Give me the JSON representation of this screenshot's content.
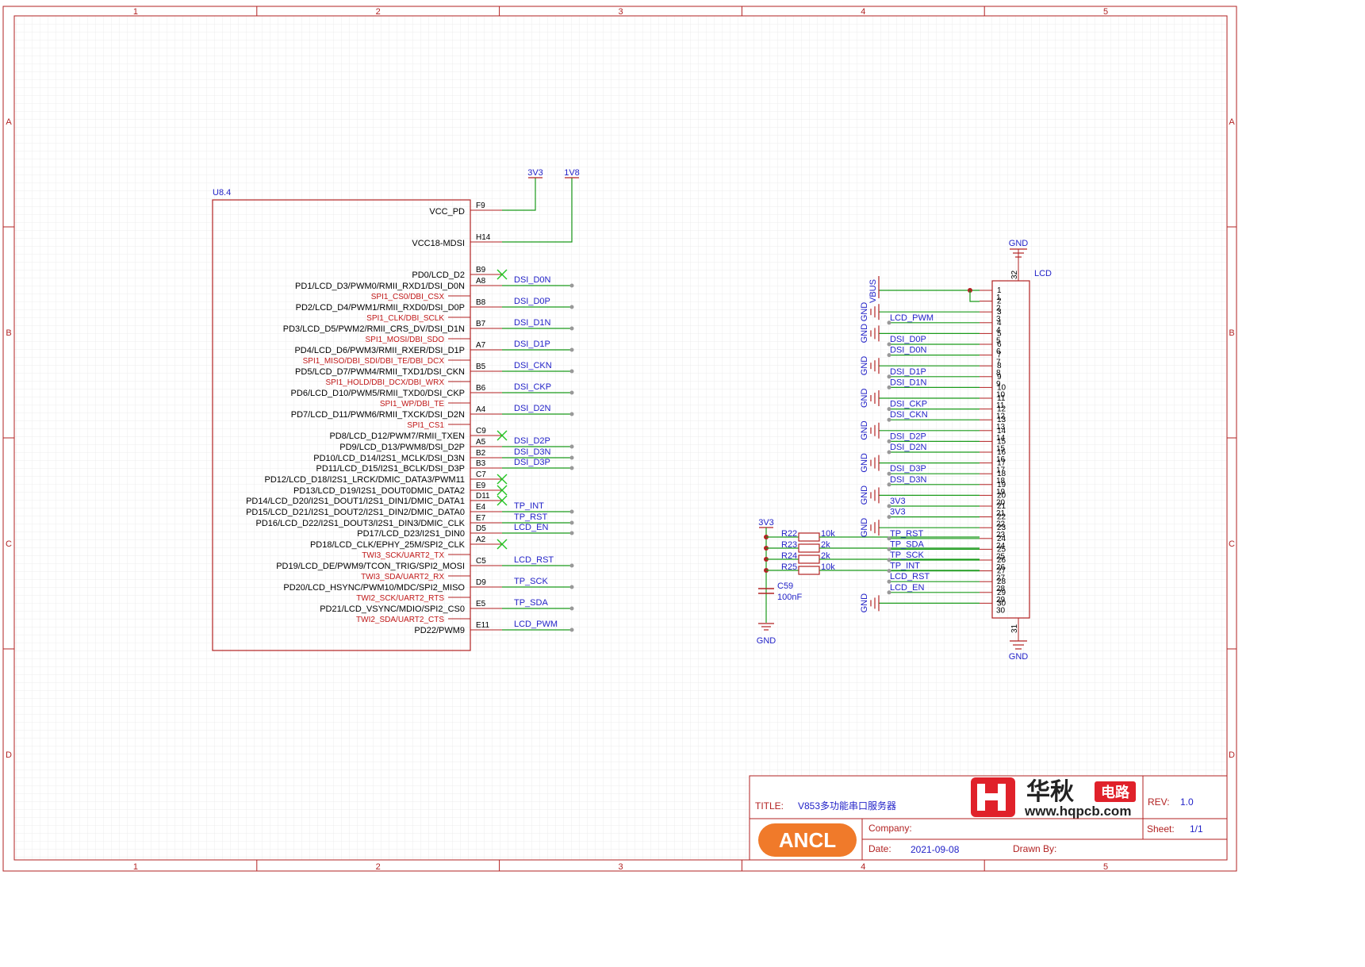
{
  "border": {
    "columns": [
      "1",
      "2",
      "3",
      "4",
      "5"
    ],
    "rows": [
      "A",
      "B",
      "C",
      "D"
    ]
  },
  "supply": {
    "rail_3v3": "3V3",
    "rail_1v8": "1V8"
  },
  "u84": {
    "ref": "U8.4",
    "power_pins": [
      {
        "name": "VCC_PD",
        "pin": "F9"
      },
      {
        "name": "VCC18-MDSI",
        "pin": "H14"
      }
    ],
    "pins": [
      {
        "name": "PD0/LCD_D2",
        "pin": "B9",
        "net": "",
        "nc": true,
        "alt": "",
        "type": "pd"
      },
      {
        "name": "PD1/LCD_D3/PWM0/RMII_RXD1/DSI_D0N",
        "pin": "A8",
        "net": "DSI_D0N",
        "nc": false,
        "alt": "SPI1_CS0/DBI_CSX",
        "type": "pd"
      },
      {
        "name": "PD2/LCD_D4/PWM1/RMII_RXD0/DSI_D0P",
        "pin": "B8",
        "net": "DSI_D0P",
        "nc": false,
        "alt": "SPI1_CLK/DBI_SCLK",
        "type": "pd"
      },
      {
        "name": "PD3/LCD_D5/PWM2/RMII_CRS_DV/DSI_D1N",
        "pin": "B7",
        "net": "DSI_D1N",
        "nc": false,
        "alt": "SPI1_MOSI/DBI_SDO",
        "type": "pd"
      },
      {
        "name": "PD4/LCD_D6/PWM3/RMII_RXER/DSI_D1P",
        "pin": "A7",
        "net": "DSI_D1P",
        "nc": false,
        "alt": "SPI1_MISO/DBI_SDI/DBI_TE/DBI_DCX",
        "type": "pd"
      },
      {
        "name": "PD5/LCD_D7/PWM4/RMII_TXD1/DSI_CKN",
        "pin": "B5",
        "net": "DSI_CKN",
        "nc": false,
        "alt": "SPI1_HOLD/DBI_DCX/DBI_WRX",
        "type": "pd"
      },
      {
        "name": "PD6/LCD_D10/PWM5/RMII_TXD0/DSI_CKP",
        "pin": "B6",
        "net": "DSI_CKP",
        "nc": false,
        "alt": "SPI1_WP/DBI_TE",
        "type": "pd"
      },
      {
        "name": "PD7/LCD_D11/PWM6/RMII_TXCK/DSI_D2N",
        "pin": "A4",
        "net": "DSI_D2N",
        "nc": false,
        "alt": "SPI1_CS1",
        "type": "pd"
      },
      {
        "name": "PD8/LCD_D12/PWM7/RMII_TXEN",
        "pin": "C9",
        "net": "",
        "nc": true,
        "alt": "",
        "type": "pd"
      },
      {
        "name": "PD9/LCD_D13/PWM8/DSI_D2P",
        "pin": "A5",
        "net": "DSI_D2P",
        "nc": false,
        "alt": "",
        "type": "pd"
      },
      {
        "name": "PD10/LCD_D14/I2S1_MCLK/DSI_D3N",
        "pin": "B2",
        "net": "DSI_D3N",
        "nc": false,
        "alt": "",
        "type": "pd"
      },
      {
        "name": "PD11/LCD_D15/I2S1_BCLK/DSI_D3P",
        "pin": "B3",
        "net": "DSI_D3P",
        "nc": false,
        "alt": "",
        "type": "pd"
      },
      {
        "name": "PD12/LCD_D18/I2S1_LRCK/DMIC_DATA3/PWM11",
        "pin": "C7",
        "net": "",
        "nc": true,
        "alt": "",
        "type": "pd"
      },
      {
        "name": "PD13/LCD_D19/I2S1_DOUT0DMIC_DATA2",
        "pin": "E9",
        "net": "",
        "nc": true,
        "alt": "",
        "type": "pd"
      },
      {
        "name": "PD14/LCD_D20/I2S1_DOUT1/I2S1_DIN1/DMIC_DATA1",
        "pin": "D11",
        "net": "",
        "nc": true,
        "alt": "",
        "type": "pd"
      },
      {
        "name": "PD15/LCD_D21/I2S1_DOUT2/I2S1_DIN2/DMIC_DATA0",
        "pin": "E4",
        "net": "TP_INT",
        "nc": false,
        "alt": "",
        "type": "pd"
      },
      {
        "name": "PD16/LCD_D22/I2S1_DOUT3/I2S1_DIN3/DMIC_CLK",
        "pin": "E7",
        "net": "TP_RST",
        "nc": false,
        "alt": "",
        "type": "pd"
      },
      {
        "name": "PD17/LCD_D23/I2S1_DIN0",
        "pin": "D5",
        "net": "LCD_EN",
        "nc": false,
        "alt": "",
        "type": "pd"
      },
      {
        "name": "PD18/LCD_CLK/EPHY_25M/SPI2_CLK",
        "pin": "A2",
        "net": "",
        "nc": true,
        "alt": "TWI3_SCK/UART2_TX",
        "type": "pd"
      },
      {
        "name": "PD19/LCD_DE/PWM9/TCON_TRIG/SPI2_MOSI",
        "pin": "C5",
        "net": "LCD_RST",
        "nc": false,
        "alt": "TWI3_SDA/UART2_RX",
        "type": "pd"
      },
      {
        "name": "PD20/LCD_HSYNC/PWM10/MDC/SPI2_MISO",
        "pin": "D9",
        "net": "TP_SCK",
        "nc": false,
        "alt": "TWI2_SCK/UART2_RTS",
        "type": "pd"
      },
      {
        "name": "PD21/LCD_VSYNC/MDIO/SPI2_CS0",
        "pin": "E5",
        "net": "TP_SDA",
        "nc": false,
        "alt": "TWI2_SDA/UART2_CTS",
        "type": "pd"
      },
      {
        "name": "PD22/PWM9",
        "pin": "E11",
        "net": "LCD_PWM",
        "nc": false,
        "alt": "",
        "type": "pd"
      }
    ]
  },
  "lcd": {
    "ref": "LCD",
    "gnd": "GND",
    "vbus": "VBUS",
    "top_pin": "32",
    "bottom_pin": "31",
    "left_nets": [
      "VBUS",
      "",
      "GND",
      "LCD_PWM",
      "GND",
      "DSI_D0P",
      "DSI_D0N",
      "GND",
      "DSI_D1P",
      "DSI_D1N",
      "GND",
      "DSI_CKP",
      "DSI_CKN",
      "GND",
      "DSI_D2P",
      "DSI_D2N",
      "GND",
      "DSI_D3P",
      "DSI_D3N",
      "GND",
      "3V3",
      "3V3",
      "GND",
      "TP_RST",
      "TP_SDA",
      "TP_SCK",
      "TP_INT",
      "LCD_RST",
      "LCD_EN",
      "GND"
    ],
    "pin_numbers": [
      "1",
      "2",
      "3",
      "4",
      "5",
      "6",
      "7",
      "8",
      "9",
      "10",
      "11",
      "12",
      "13",
      "14",
      "15",
      "16",
      "17",
      "18",
      "19",
      "20",
      "21",
      "22",
      "23",
      "24",
      "25",
      "26",
      "27",
      "28",
      "29",
      "30"
    ]
  },
  "pullups": {
    "rail": "3V3",
    "resistors": [
      {
        "ref": "R22",
        "value": "10k"
      },
      {
        "ref": "R23",
        "value": "2k"
      },
      {
        "ref": "R24",
        "value": "2k"
      },
      {
        "ref": "R25",
        "value": "10k"
      }
    ],
    "cap_ref": "C59",
    "cap_value": "100nF",
    "gnd": "GND"
  },
  "title_block": {
    "title_label": "TITLE:",
    "title": "V853多功能串口服务器",
    "rev_label": "REV:",
    "rev": "1.0",
    "company_label": "Company:",
    "sheet_label": "Sheet:",
    "sheet": "1/1",
    "date_label": "Date:",
    "date": "2021-09-08",
    "drawn_label": "Drawn By:",
    "brand_cn": "华秋",
    "brand_tag": "电路",
    "brand_url": "www.hqpcb.com",
    "logo_text": "ANCL"
  },
  "colors": {
    "component": "#b22222",
    "wire": "#1a9a1a",
    "net_label": "#2323c8",
    "alt_function": "#c01818",
    "grid": "#ececec",
    "nc_mark": "#22c422"
  }
}
